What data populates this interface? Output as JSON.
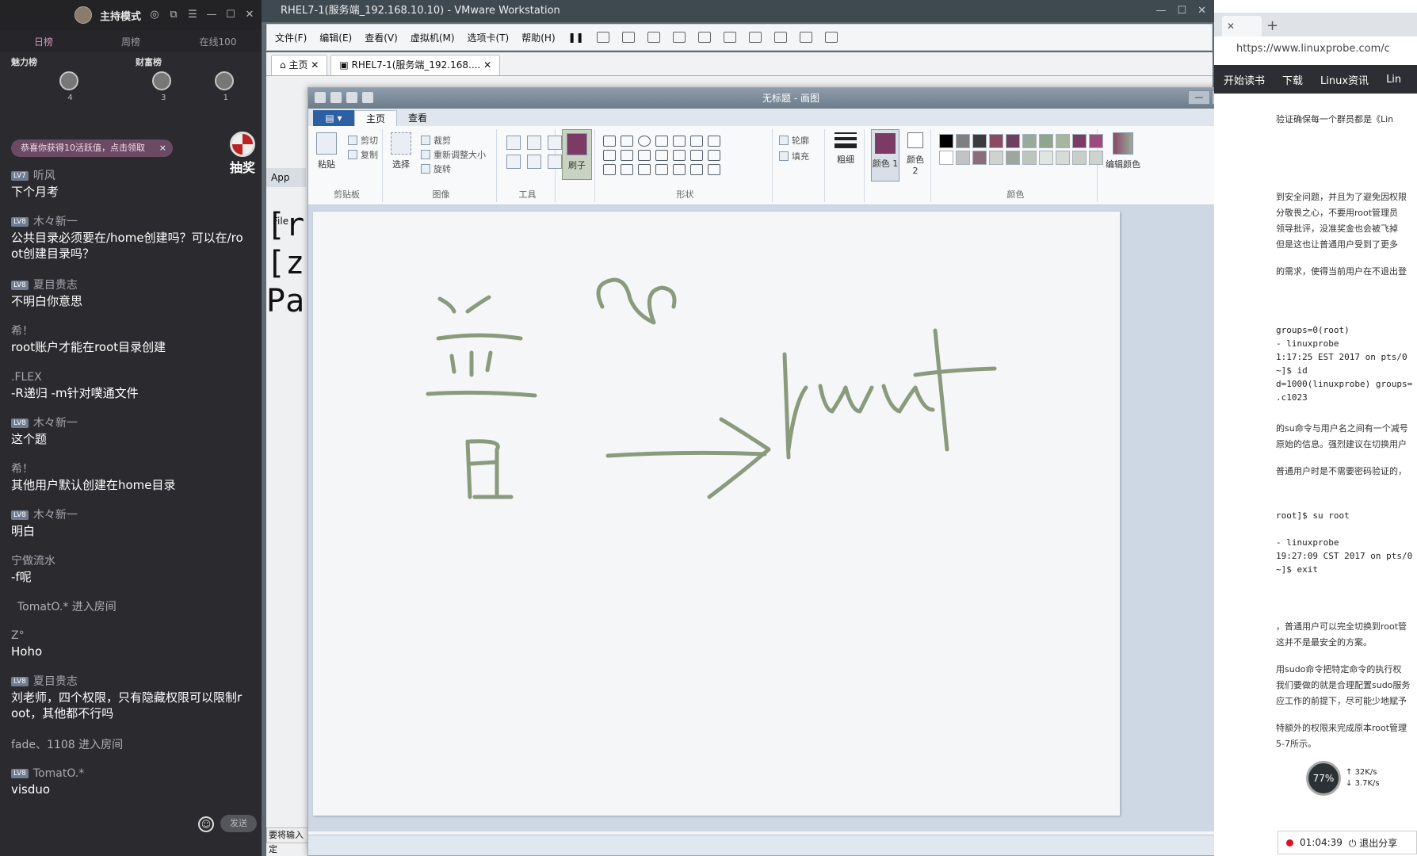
{
  "live": {
    "mode_label": "主持模式",
    "rank_tabs": [
      "日榜",
      "周榜",
      "在线100"
    ],
    "boards": {
      "charm": "魅力榜",
      "wealth": "财富榜",
      "ranks": [
        "4",
        "3",
        "1"
      ]
    },
    "gift_pill": "恭喜你获得10活跃值，点击领取",
    "lottery": "抽奖",
    "chats": [
      {
        "name": "听风",
        "level": "LV7",
        "msg": "下个月考"
      },
      {
        "name": "木々新一",
        "level": "LV8",
        "msg": "公共目录必须要在/home创建吗？可以在/ro"
      },
      {
        "name": "",
        "level": "",
        "msg": "ot创建目录吗？"
      },
      {
        "name": "夏目贵志",
        "level": "LV8",
        "msg": "不明白你意思"
      },
      {
        "name": "希！",
        "level": "",
        "msg": "root账户才能在root目录创建"
      },
      {
        "name": ".FLEX",
        "level": "",
        "msg": "-R递归 -m针对噗通文件"
      },
      {
        "name": "木々新一",
        "level": "LV8",
        "msg": "这个题"
      },
      {
        "name": "希！",
        "level": "",
        "msg": "其他用户默认创建在home目录"
      },
      {
        "name": "木々新一",
        "level": "LV8",
        "msg": "明白"
      },
      {
        "name": "宁做流水",
        "level": "",
        "msg": "-f呢"
      },
      {
        "name": "",
        "level": "",
        "msg": ""
      },
      {
        "name": "Z°",
        "level": "",
        "msg": "Hoho"
      },
      {
        "name": "夏目贵志",
        "level": "LV8",
        "msg": "刘老师，四个权限，只有隐藏权限可以限制r"
      },
      {
        "name": "",
        "level": "",
        "msg": "oot，其他都不行吗"
      },
      {
        "name": "TomatO.*",
        "level": "LV8",
        "msg": "visduo"
      }
    ],
    "system_msgs": [
      "TomatO.* 进入房间",
      "fade、1108 进入房间"
    ],
    "send_label": "发送"
  },
  "vmware": {
    "title": "RHEL7-1(服务端_192.168.10.10) - VMware Workstation",
    "menu": [
      "文件(F)",
      "编辑(E)",
      "查看(V)",
      "虚拟机(M)",
      "选项卡(T)",
      "帮助(H)"
    ],
    "tabs": [
      "主页",
      "RHEL7-1(服务端_192.168...."
    ],
    "app_label": "App",
    "file_label": "File",
    "term_lines": [
      "[r",
      "[z",
      "Pa"
    ],
    "status_label": "要将输入定"
  },
  "paint": {
    "title": "无标题 - 画图",
    "tabs": [
      "主页",
      "查看"
    ],
    "groups": {
      "clipboard": "剪贴板",
      "image": "图像",
      "tools": "工具",
      "shapes": "形状",
      "colors": "颜色"
    },
    "buttons": {
      "paste": "粘贴",
      "cut": "剪切",
      "copy": "复制",
      "select": "选择",
      "crop": "裁剪",
      "resize": "重新调整大小",
      "rotate": "旋转",
      "brush": "刷子",
      "outline": "轮廓",
      "fill": "填充",
      "size": "粗细",
      "color1": "颜色 1",
      "color2": "颜色 2",
      "edit_colors": "编辑颜色"
    },
    "drawing": {
      "text": "root",
      "stroke_color": "#8a9a7c"
    },
    "palette": [
      "#000000",
      "#7f7f7f",
      "#3b3b3b",
      "#8a4a63",
      "#6d4060",
      "#99aa9d",
      "#8fa58f",
      "#a6b7a0",
      "#7b3b64",
      "#9b4c7c",
      "#ffffff",
      "#c3c3c3",
      "#8a6d7a",
      "#cfd3cf",
      "#9ea79e",
      "#bcc6bc",
      "#e1e5e1",
      "#d6dbd6",
      "#c8cfc8",
      "#cdd3cd"
    ]
  },
  "browser": {
    "url": "https://www.linuxprobe.com/c",
    "nav": [
      "开始读书",
      "下载",
      "Linux资讯",
      "Lin"
    ],
    "text_lines": [
      "验证确保每一个群员都是《Lin",
      "到安全问题，并且为了避免因权限",
      "分敬畏之心，不要用root管理员",
      "领导批评，没准奖金也会被飞掉",
      "但是这也让普通用户受到了更多",
      "的需求，使得当前用户在不退出登"
    ],
    "code_lines": [
      "groups=0(root)",
      "- linuxprobe",
      "1:17:25 EST 2017 on pts/0",
      "~]$ id",
      "d=1000(linuxprobe) groups=",
      ".c1023"
    ],
    "text_lines2": [
      "的su命令与用户名之间有一个减号",
      "原始的信息。强烈建议在切换用户",
      "普通用户时是不需要密码验证的，"
    ],
    "code_lines2": [
      "root]$ su root",
      "- linuxprobe",
      "19:27:09 CST 2017 on pts/0",
      "~]$ exit"
    ],
    "text_lines3": [
      "，普通用户可以完全切换到root管",
      "这并不是最安全的方案。",
      "用sudo命令把特定命令的执行权",
      "我们要做的就是合理配置sudo服务",
      "应工作的前提下，尽可能少地赋予",
      "特额外的权限来完成原本root管理",
      "5-7所示。"
    ],
    "speed": {
      "percent": "77%",
      "up": "32K/s",
      "down": "3.7K/s"
    },
    "rec_time": "01:04:39",
    "rec_exit": "退出分享"
  }
}
